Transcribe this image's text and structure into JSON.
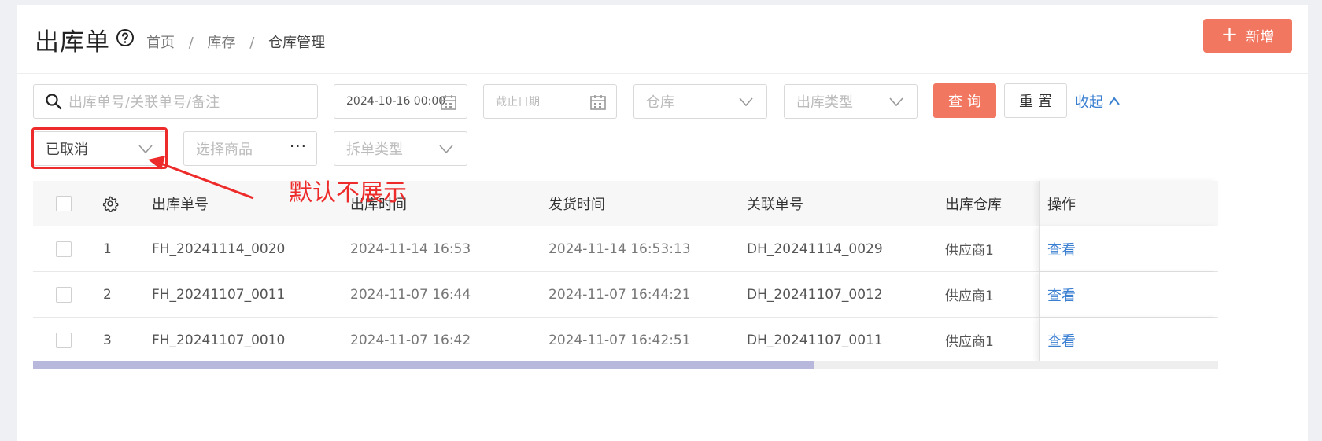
{
  "header": {
    "title": "出库单",
    "breadcrumb": [
      "首页",
      "库存",
      "仓库管理"
    ],
    "new_button": "新增"
  },
  "filters": {
    "search_placeholder": "出库单号/关联单号/备注",
    "start_date": "2024-10-16 00:00",
    "end_date_placeholder": "截止日期",
    "warehouse_placeholder": "仓库",
    "outbound_type_placeholder": "出库类型",
    "query_button": "查询",
    "reset_button": "重置",
    "collapse_link": "收起",
    "status_value": "已取消",
    "product_placeholder": "选择商品",
    "split_type_placeholder": "拆单类型"
  },
  "annotation": {
    "text": "默认不展示",
    "color": "#ee2b2b"
  },
  "table": {
    "columns": [
      "出库单号",
      "出库时间",
      "发货时间",
      "关联单号",
      "出库仓库",
      "操作"
    ],
    "rows": [
      {
        "index": "1",
        "order_no": "FH_20241114_0020",
        "out_time": "2024-11-14 16:53",
        "ship_time": "2024-11-14 16:53:13",
        "related_no": "DH_20241114_0029",
        "warehouse": "供应商1",
        "action": "查看"
      },
      {
        "index": "2",
        "order_no": "FH_20241107_0011",
        "out_time": "2024-11-07 16:44",
        "ship_time": "2024-11-07 16:44:21",
        "related_no": "DH_20241107_0012",
        "warehouse": "供应商1",
        "action": "查看"
      },
      {
        "index": "3",
        "order_no": "FH_20241107_0010",
        "out_time": "2024-11-07 16:42",
        "ship_time": "2024-11-07 16:42:51",
        "related_no": "DH_20241107_0011",
        "warehouse": "供应商1",
        "action": "查看"
      }
    ]
  },
  "colors": {
    "accent": "#f27760",
    "link": "#3b7fd1"
  }
}
